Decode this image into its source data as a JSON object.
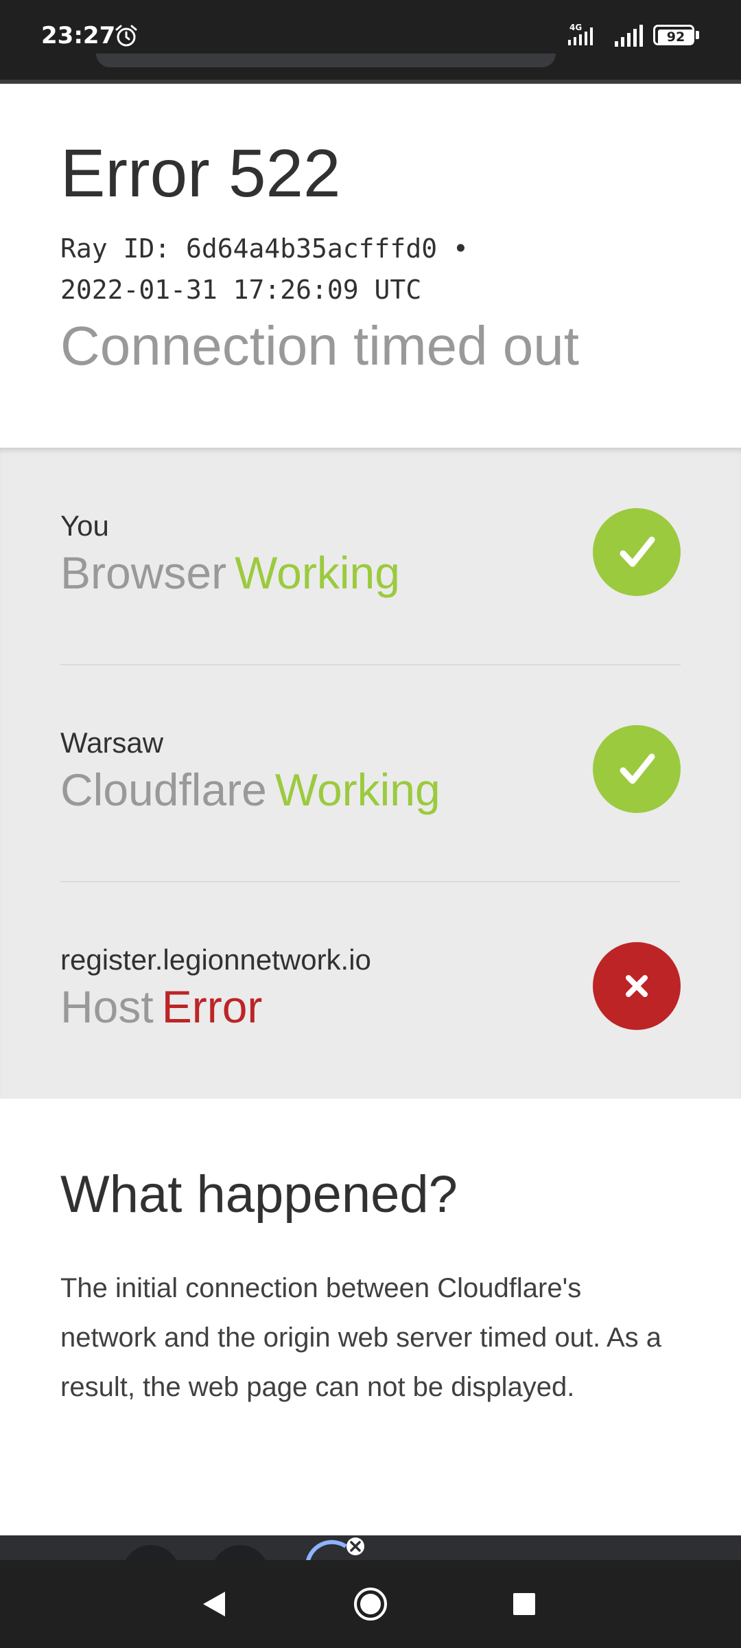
{
  "status_bar": {
    "time": "23:27",
    "network_type": "4G",
    "battery_level": "92",
    "icons": [
      "alarm-icon",
      "signal-4g-icon",
      "signal-bars-icon",
      "battery-icon"
    ]
  },
  "header": {
    "title": "Error 522",
    "ray_line_1": "Ray ID: 6d64a4b35acfffd0 •",
    "ray_line_2": "2022-01-31 17:26:09 UTC",
    "subtitle": "Connection timed out"
  },
  "status_rows": [
    {
      "location": "You",
      "item": "Browser",
      "state": "Working",
      "status": "ok",
      "icon": "check-icon"
    },
    {
      "location": "Warsaw",
      "item": "Cloudflare",
      "state": "Working",
      "status": "ok",
      "icon": "check-icon"
    },
    {
      "location": "register.legionnetwork.io",
      "item": "Host",
      "state": "Error",
      "status": "error",
      "icon": "cross-icon"
    }
  ],
  "info": {
    "heading": "What happened?",
    "body": "The initial connection between Cloudflare's network and the origin web server timed out. As a result, the web page can not be displayed."
  },
  "navigation": {
    "icons": [
      "back-icon",
      "home-icon",
      "recents-icon"
    ]
  },
  "colors": {
    "working": "#9bca3e",
    "error": "#bd2426",
    "muted_text": "#999999",
    "dark_text": "#313131",
    "status_bg": "#ebebeb",
    "system_bar": "#202020"
  }
}
